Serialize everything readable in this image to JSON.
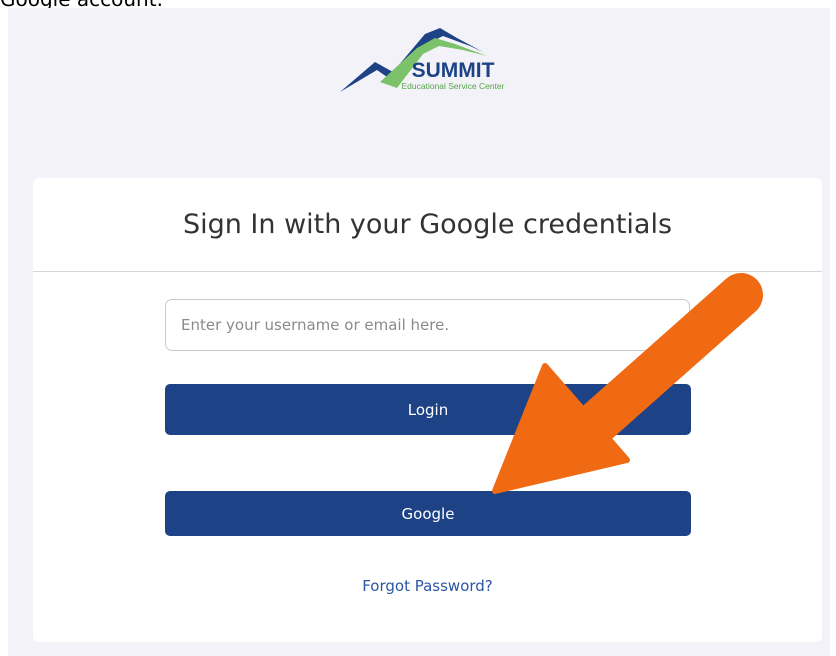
{
  "caption": "Google account.",
  "logo": {
    "name": "SUMMIT",
    "subtitle": "Educational Service Center"
  },
  "card": {
    "title": "Sign In with your Google credentials"
  },
  "form": {
    "username_placeholder": "Enter your username or email here.",
    "username_value": "",
    "login_label": "Login",
    "google_label": "Google",
    "forgot_label": "Forgot Password?"
  },
  "colors": {
    "page_background": "#f2f2f8",
    "button": "#1d4285",
    "link": "#2a56a6",
    "arrow": "#f06a13",
    "logo_mountain_blue": "#1d4285",
    "logo_mountain_green": "#7cc26b"
  }
}
